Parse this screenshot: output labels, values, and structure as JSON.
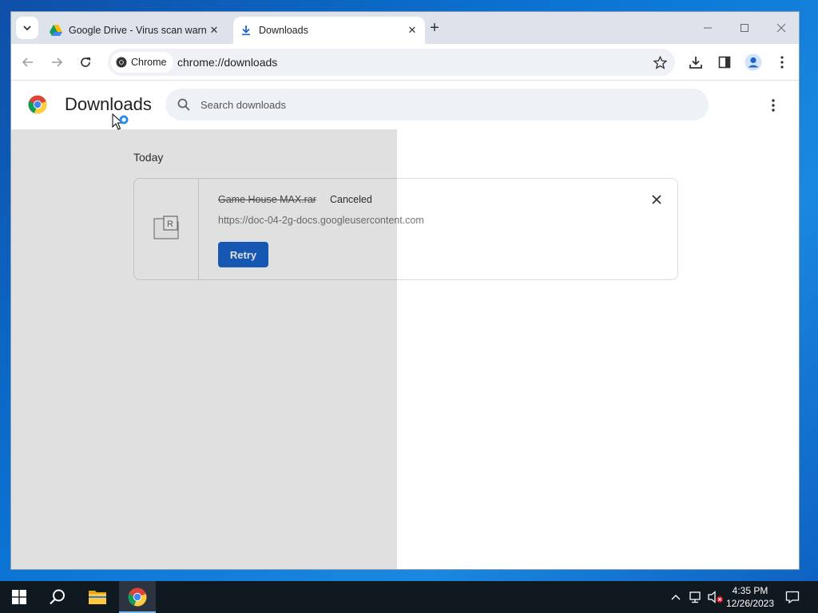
{
  "browser": {
    "tabs": [
      {
        "title": "Google Drive - Virus scan warni",
        "active": false,
        "icon": "google-drive-icon"
      },
      {
        "title": "Downloads",
        "active": true,
        "icon": "download-icon"
      }
    ],
    "new_tab_label": "+",
    "omnibox": {
      "chip_label": "Chrome",
      "url": "chrome://downloads"
    }
  },
  "page": {
    "title": "Downloads",
    "search_placeholder": "Search downloads",
    "section_label": "Today",
    "downloads": [
      {
        "file_name": "Game House MAX.rar",
        "status": "Canceled",
        "source_url": "https://doc-04-2g-docs.googleusercontent.com",
        "action_label": "Retry"
      }
    ]
  },
  "taskbar": {
    "time": "4:35 PM",
    "date": "12/26/2023"
  },
  "colors": {
    "accent": "#1a64cc",
    "tabstrip": "#dee3eb",
    "omnibox": "#eef1f6"
  }
}
